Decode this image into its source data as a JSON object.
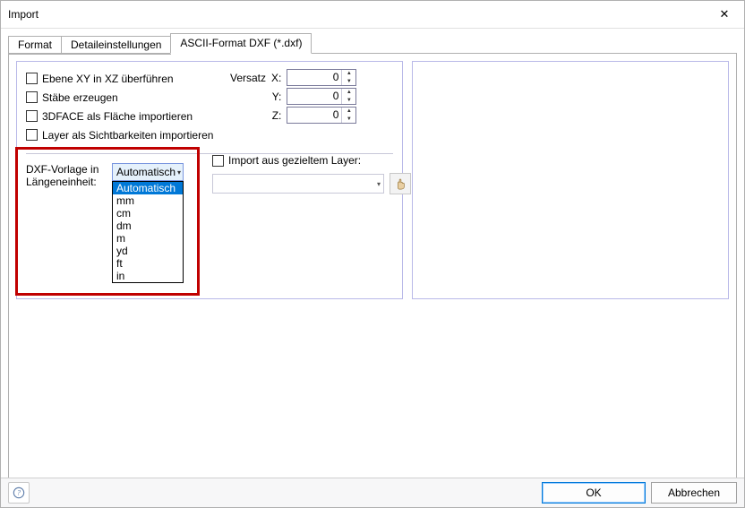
{
  "window": {
    "title": "Import"
  },
  "tabs": {
    "t0": "Format",
    "t1": "Detaileinstellungen",
    "t2": "ASCII-Format DXF (*.dxf)"
  },
  "checks": {
    "c0": "Ebene XY in XZ überführen",
    "c1": "Stäbe erzeugen",
    "c2": "3DFACE als Fläche importieren",
    "c3": "Layer als Sichtbarkeiten importieren"
  },
  "offset": {
    "label": "Versatz",
    "x_label": "X:",
    "y_label": "Y:",
    "z_label": "Z:",
    "x": "0",
    "y": "0",
    "z": "0"
  },
  "unit": {
    "label1": "DXF-Vorlage in",
    "label2": "Längeneinheit:",
    "selected": "Automatisch",
    "options": [
      "Automatisch",
      "mm",
      "cm",
      "dm",
      "m",
      "yd",
      "ft",
      "in"
    ]
  },
  "layer": {
    "check_label": "Import aus gezieltem Layer:",
    "combo_value": ""
  },
  "footer": {
    "ok": "OK",
    "cancel": "Abbrechen"
  }
}
